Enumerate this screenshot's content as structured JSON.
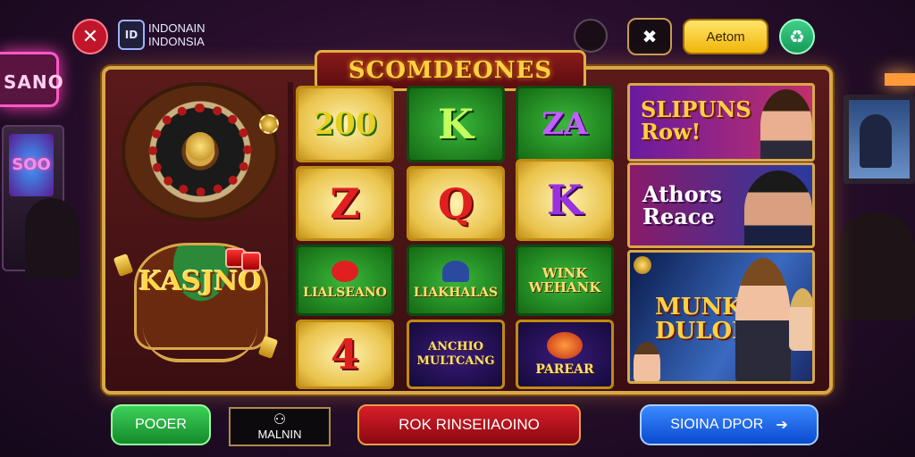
{
  "header": {
    "brand_logo": "ID",
    "brand_line1": "INDONAIN",
    "brand_line2": "INDONSIA",
    "action_label": "Aetom"
  },
  "title": "SCOMDEONES",
  "left_panel": {
    "kasino_label": "KASJNO"
  },
  "slot_grid": {
    "row1": [
      "200",
      "K",
      "ZA"
    ],
    "row2": [
      "Z",
      "Q",
      "K"
    ],
    "row3": [
      "LIALSEANO",
      "LIAKHALAS",
      "WINK WEHANK"
    ],
    "row4": [
      "4",
      "ANCHIO MULTCANG",
      "PAREAR"
    ]
  },
  "promos": [
    {
      "line1": "SLIPUNS",
      "line2": "Row!"
    },
    {
      "line1": "Athors",
      "line2": "Reace"
    },
    {
      "line1": "MUNK",
      "line2": "DULORS"
    }
  ],
  "footer": {
    "green_label": "POOER",
    "dark_label": "MALNIN",
    "red_label": "ROK RINSEIIAOINO",
    "blue_label": "SIOINA DPOR"
  },
  "bg": {
    "sign_text": "SANO",
    "screen_text": "SOO"
  },
  "colors": {
    "gold": "#d8a848",
    "accent_red": "#c0152a",
    "accent_green": "#2fb85a",
    "accent_blue": "#1a6aff"
  },
  "icons": [
    "close-icon",
    "brand-logo-icon",
    "tools-icon",
    "refresh-icon",
    "arrow-right-icon"
  ]
}
